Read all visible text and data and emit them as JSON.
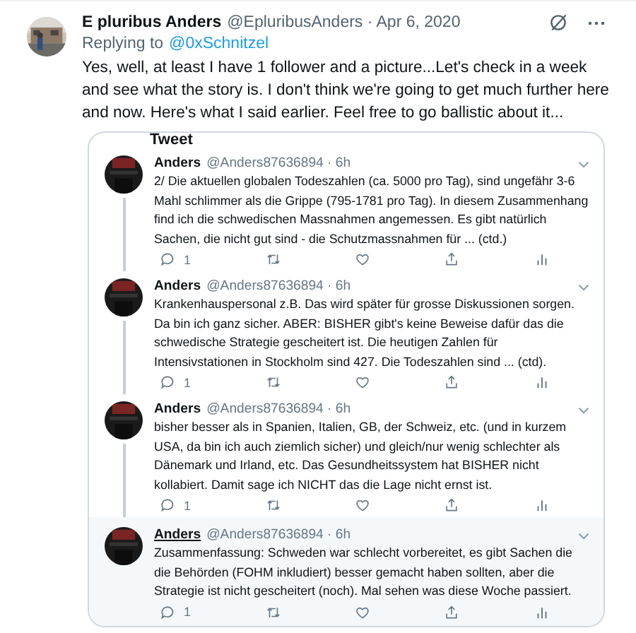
{
  "tweet": {
    "display_name": "E pluribus Anders",
    "meta": "@EpluribusAnders · Apr 6, 2020",
    "replying_label": "Replying to",
    "replying_to": "@0xSchnitzel",
    "text": "Yes, well, at least I have 1 follower and a picture...Let's check in a week and see what the story is. I don't think we're going to get much further here and now. Here's what I said earlier. Feel free to go ballistic about it..."
  },
  "embedded": {
    "header": "Tweet",
    "replies": [
      {
        "name": "Anders",
        "meta": "@Anders87636894 · 6h",
        "text": "2/ Die aktuellen globalen Todeszahlen (ca. 5000 pro Tag), sind ungefähr 3-6 Mahl schlimmer als die Grippe (795-1781 pro Tag). In diesem Zusammenhang find ich die schwedischen Massnahmen angemessen. Es gibt natürlich Sachen, die nicht gut sind - die Schutzmassnahmen für ... (ctd.)",
        "reply_count": "1",
        "highlighted": false
      },
      {
        "name": "Anders",
        "meta": "@Anders87636894 · 6h",
        "text": "Krankenhauspersonal z.B. Das wird später für grosse Diskussionen sorgen. Da bin ich ganz sicher. ABER: BISHER gibt's keine Beweise dafür das die schwedische Strategie gescheitert ist. Die heutigen Zahlen für Intensivstationen in Stockholm sind 427. Die Todeszahlen sind ... (ctd).",
        "reply_count": "1",
        "highlighted": false
      },
      {
        "name": "Anders",
        "meta": "@Anders87636894 · 6h",
        "text": "bisher besser als in Spanien, Italien, GB, der Schweiz, etc. (und in kurzem USA, da bin ich auch ziemlich sicher) und gleich/nur wenig schlechter als Dänemark und Irland, etc. Das Gesundheitssystem hat BISHER nicht kollabiert. Damit sage ich NICHT das die Lage nicht ernst ist.",
        "reply_count": "1",
        "highlighted": false
      },
      {
        "name": "Anders",
        "meta": "@Anders87636894 · 6h",
        "text": "Zusammenfassung: Schweden war schlecht vorbereitet, es gibt Sachen die die Behörden (FOHM inkludiert) besser gemacht haben sollten, aber die Strategie ist nicht gescheitert (noch). Mal sehen was diese Woche passiert.",
        "reply_count": "1",
        "highlighted": true
      }
    ]
  }
}
